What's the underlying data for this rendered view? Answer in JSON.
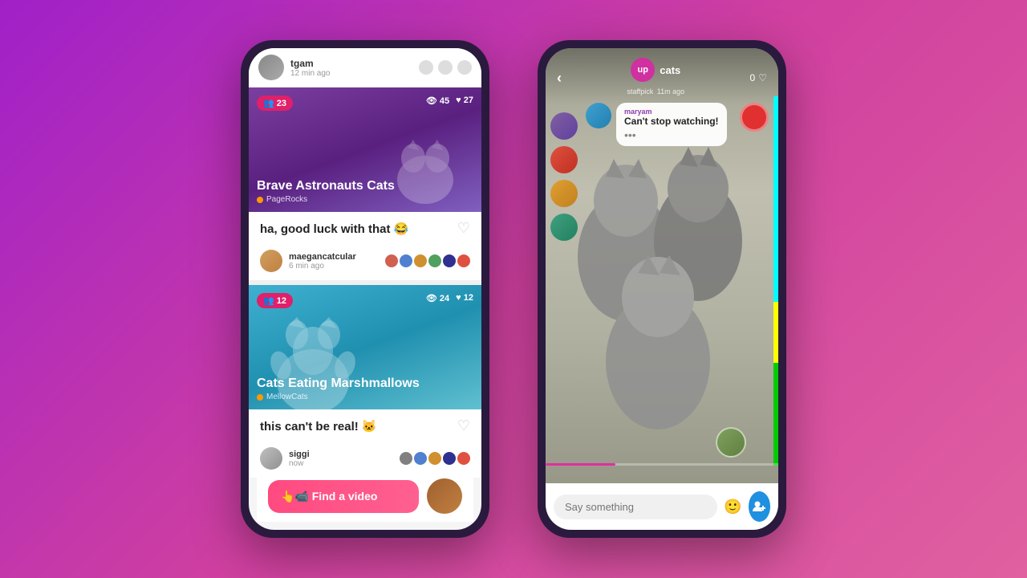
{
  "background": {
    "gradient_start": "#a020c8",
    "gradient_end": "#e060a0"
  },
  "left_phone": {
    "header": {
      "username": "tgam",
      "time": "12 min ago"
    },
    "card1": {
      "badge": "23",
      "views": "45",
      "likes": "27",
      "title": "Brave Astronauts Cats",
      "channel": "PageRocks"
    },
    "comment1": {
      "text": "ha, good luck with that 😂",
      "commenter": "maegancatcular",
      "time": "6 min ago"
    },
    "card2": {
      "badge": "12",
      "views": "24",
      "likes": "12",
      "title": "Cats Eating Marshmallows",
      "channel": "MellowCats"
    },
    "comment2": {
      "text": "this can't be real! 🐱",
      "commenter": "siggi",
      "time": "now"
    },
    "find_video_btn": "👆📹 Find a video"
  },
  "right_phone": {
    "title": "cats",
    "staffpick_label": "staffpick",
    "staffpick_time": "11m ago",
    "like_count": "0",
    "chat": {
      "user": "maryam",
      "message": "Can't stop watching!",
      "dots": "•••"
    },
    "say_something_placeholder": "Say something"
  }
}
